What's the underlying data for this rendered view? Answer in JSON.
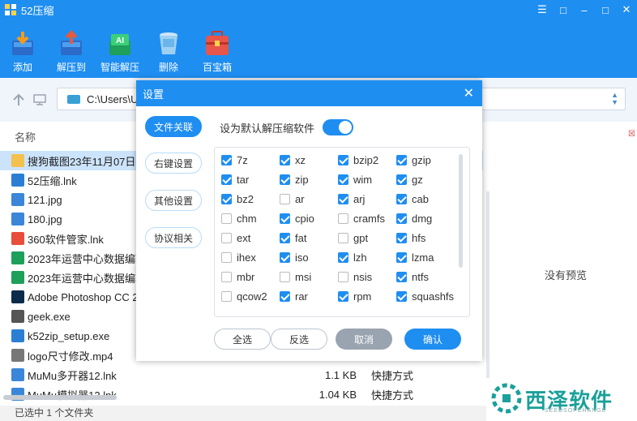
{
  "app": {
    "title": "52压缩",
    "window_controls": [
      "≡",
      "□",
      "–",
      "□",
      "✕"
    ]
  },
  "toolbar": {
    "items": [
      {
        "label": "添加",
        "icon": "add-archive-icon"
      },
      {
        "label": "解压到",
        "icon": "extract-to-icon"
      },
      {
        "label": "智能解压",
        "icon": "smart-extract-icon"
      },
      {
        "label": "删除",
        "icon": "delete-icon"
      },
      {
        "label": "百宝箱",
        "icon": "toolbox-icon"
      }
    ]
  },
  "address": {
    "path": "C:\\Users\\U"
  },
  "filelist": {
    "header_name": "名称",
    "rows": [
      {
        "name": "搜狗截图23年11月07日0",
        "size": "",
        "type": "",
        "icon_color": "#f2c14e",
        "selected": true
      },
      {
        "name": "52压缩.lnk",
        "size": "",
        "type": "",
        "icon_color": "#2a7fd4"
      },
      {
        "name": "121.jpg",
        "size": "",
        "type": "",
        "icon_color": "#3c86d9"
      },
      {
        "name": "180.jpg",
        "size": "",
        "type": "",
        "icon_color": "#3c86d9"
      },
      {
        "name": "360软件管家.lnk",
        "size": "",
        "type": "",
        "icon_color": "#e94e3c"
      },
      {
        "name": "2023年运营中心数据编辑",
        "size": "",
        "type": "",
        "icon_color": "#1e9f5a"
      },
      {
        "name": "2023年运营中心数据编辑",
        "size": "",
        "type": "",
        "icon_color": "#1e9f5a"
      },
      {
        "name": "Adobe Photoshop CC 2",
        "size": "",
        "type": "",
        "icon_color": "#0b2b4a"
      },
      {
        "name": "geek.exe",
        "size": "",
        "type": "",
        "icon_color": "#555555"
      },
      {
        "name": "k52zip_setup.exe",
        "size": "",
        "type": "",
        "icon_color": "#2a7fd4"
      },
      {
        "name": "logo尺寸修改.mp4",
        "size": "",
        "type": "",
        "icon_color": "#777777"
      },
      {
        "name": "MuMu多开器12.lnk",
        "size": "1.1 KB",
        "type": "快捷方式",
        "icon_color": "#3c86d9"
      },
      {
        "name": "MuMu模拟器12.lnk",
        "size": "1.04 KB",
        "type": "快捷方式",
        "icon_color": "#3c86d9"
      }
    ]
  },
  "status": {
    "text": "已选中 1 个文件夹"
  },
  "preview": {
    "text": "没有预览"
  },
  "watermark": {
    "text": "西泽软件",
    "sub": "SEEDSOFCHANGE"
  },
  "dialog": {
    "title": "设置",
    "side_tabs": [
      {
        "label": "文件关联",
        "active": true
      },
      {
        "label": "右键设置",
        "active": false
      },
      {
        "label": "其他设置",
        "active": false
      },
      {
        "label": "协议相关",
        "active": false
      }
    ],
    "default_label": "设为默认解压缩软件",
    "default_on": true,
    "formats": [
      [
        "7z",
        true
      ],
      [
        "xz",
        true
      ],
      [
        "bzip2",
        true
      ],
      [
        "gzip",
        true
      ],
      [
        "tar",
        true
      ],
      [
        "zip",
        true
      ],
      [
        "wim",
        true
      ],
      [
        "gz",
        true
      ],
      [
        "bz2",
        true
      ],
      [
        "ar",
        false
      ],
      [
        "arj",
        true
      ],
      [
        "cab",
        true
      ],
      [
        "chm",
        false
      ],
      [
        "cpio",
        true
      ],
      [
        "cramfs",
        false
      ],
      [
        "dmg",
        true
      ],
      [
        "ext",
        false
      ],
      [
        "fat",
        true
      ],
      [
        "gpt",
        false
      ],
      [
        "hfs",
        true
      ],
      [
        "ihex",
        false
      ],
      [
        "iso",
        true
      ],
      [
        "lzh",
        true
      ],
      [
        "lzma",
        true
      ],
      [
        "mbr",
        false
      ],
      [
        "msi",
        false
      ],
      [
        "nsis",
        false
      ],
      [
        "ntfs",
        true
      ],
      [
        "qcow2",
        false
      ],
      [
        "rar",
        true
      ],
      [
        "rpm",
        true
      ],
      [
        "squashfs",
        true
      ]
    ],
    "buttons": {
      "select_all": "全选",
      "invert": "反选",
      "cancel": "取消",
      "ok": "确认"
    }
  },
  "colors": {
    "accent": "#1f8ef1",
    "cancel": "#9aa4b0"
  }
}
